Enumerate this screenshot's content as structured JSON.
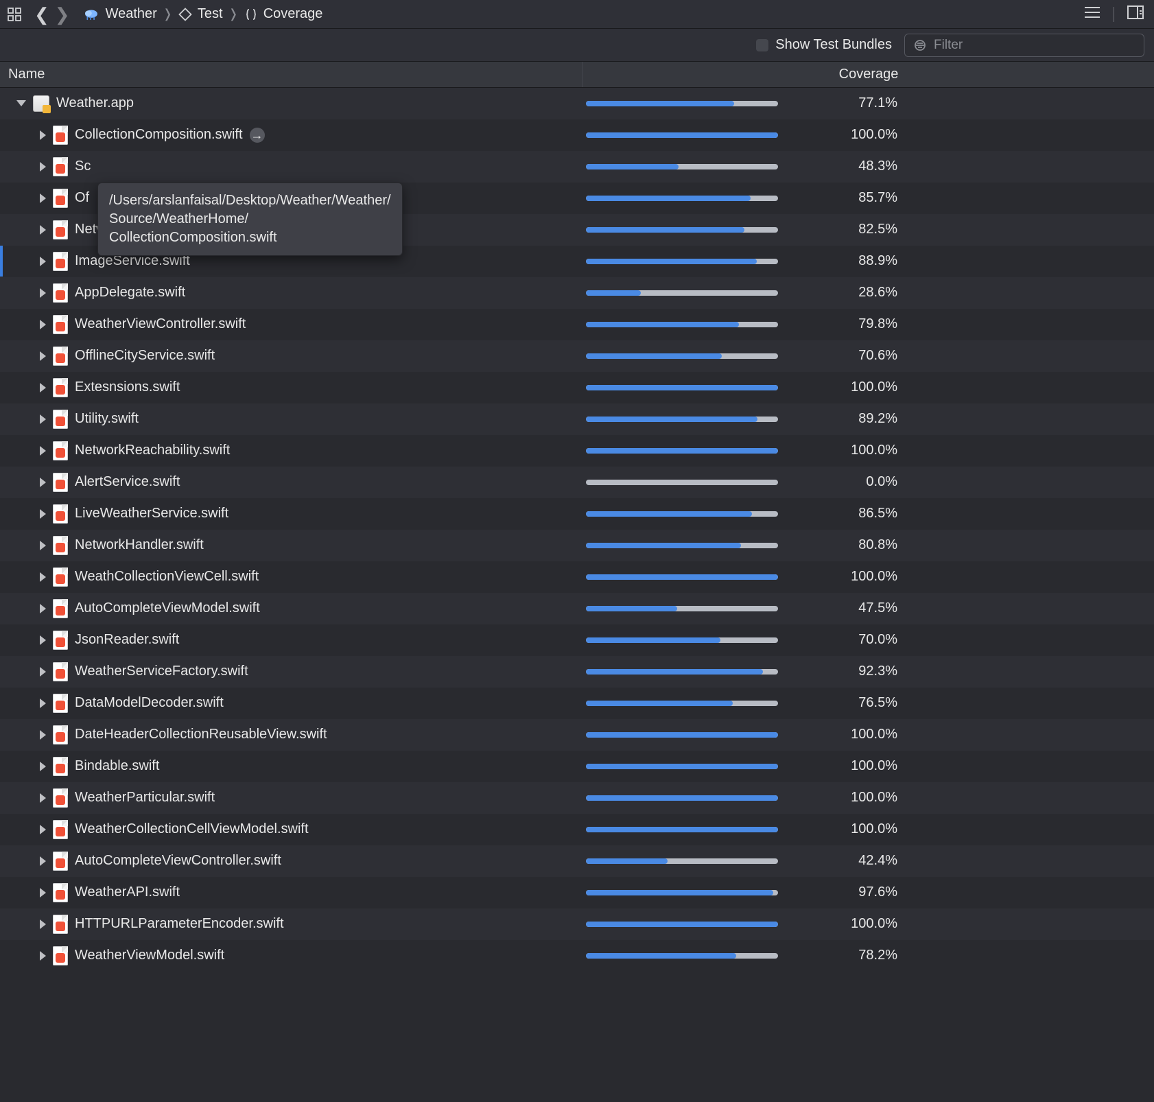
{
  "breadcrumb": {
    "item0": "Weather",
    "item1": "Test",
    "item2": "Coverage"
  },
  "filterbar": {
    "show_bundles_label": "Show Test Bundles",
    "filter_placeholder": "Filter"
  },
  "columns": {
    "name": "Name",
    "coverage": "Coverage"
  },
  "root": {
    "name": "Weather.app",
    "coverage": "77.1%",
    "coverage_pct": 77.1
  },
  "tooltip": {
    "line1": "/Users/arslanfaisal/Desktop/Weather/Weather/",
    "line2": "Source/WeatherHome/",
    "line3": "CollectionComposition.swift"
  },
  "files": [
    {
      "name": "CollectionComposition.swift",
      "coverage": "100.0%",
      "pct": 100.0,
      "has_plus": true
    },
    {
      "name": "Sc",
      "coverage": "48.3%",
      "pct": 48.3
    },
    {
      "name": "Of",
      "coverage": "85.7%",
      "pct": 85.7
    },
    {
      "name": "NetworkRouter.swift",
      "coverage": "82.5%",
      "pct": 82.5
    },
    {
      "name": "ImageService.swift",
      "coverage": "88.9%",
      "pct": 88.9,
      "selected": true
    },
    {
      "name": "AppDelegate.swift",
      "coverage": "28.6%",
      "pct": 28.6
    },
    {
      "name": "WeatherViewController.swift",
      "coverage": "79.8%",
      "pct": 79.8
    },
    {
      "name": "OfflineCityService.swift",
      "coverage": "70.6%",
      "pct": 70.6
    },
    {
      "name": "Extesnsions.swift",
      "coverage": "100.0%",
      "pct": 100.0
    },
    {
      "name": "Utility.swift",
      "coverage": "89.2%",
      "pct": 89.2
    },
    {
      "name": "NetworkReachability.swift",
      "coverage": "100.0%",
      "pct": 100.0
    },
    {
      "name": "AlertService.swift",
      "coverage": "0.0%",
      "pct": 0.0
    },
    {
      "name": "LiveWeatherService.swift",
      "coverage": "86.5%",
      "pct": 86.5
    },
    {
      "name": "NetworkHandler.swift",
      "coverage": "80.8%",
      "pct": 80.8
    },
    {
      "name": "WeathCollectionViewCell.swift",
      "coverage": "100.0%",
      "pct": 100.0
    },
    {
      "name": "AutoCompleteViewModel.swift",
      "coverage": "47.5%",
      "pct": 47.5
    },
    {
      "name": "JsonReader.swift",
      "coverage": "70.0%",
      "pct": 70.0
    },
    {
      "name": "WeatherServiceFactory.swift",
      "coverage": "92.3%",
      "pct": 92.3
    },
    {
      "name": "DataModelDecoder.swift",
      "coverage": "76.5%",
      "pct": 76.5
    },
    {
      "name": "DateHeaderCollectionReusableView.swift",
      "coverage": "100.0%",
      "pct": 100.0
    },
    {
      "name": "Bindable.swift",
      "coverage": "100.0%",
      "pct": 100.0
    },
    {
      "name": "WeatherParticular.swift",
      "coverage": "100.0%",
      "pct": 100.0
    },
    {
      "name": "WeatherCollectionCellViewModel.swift",
      "coverage": "100.0%",
      "pct": 100.0
    },
    {
      "name": "AutoCompleteViewController.swift",
      "coverage": "42.4%",
      "pct": 42.4
    },
    {
      "name": "WeatherAPI.swift",
      "coverage": "97.6%",
      "pct": 97.6
    },
    {
      "name": "HTTPURLParameterEncoder.swift",
      "coverage": "100.0%",
      "pct": 100.0
    },
    {
      "name": "WeatherViewModel.swift",
      "coverage": "78.2%",
      "pct": 78.2
    }
  ],
  "colors": {
    "progress_fill": "#4a8ae4",
    "progress_track": "#b8bcc4",
    "selection": "#3a7ee0"
  }
}
